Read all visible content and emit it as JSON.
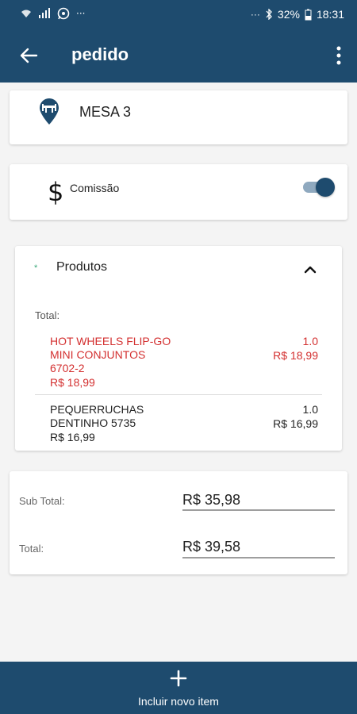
{
  "status_bar": {
    "battery": "32%",
    "time": "18:31",
    "left_icons": [
      "wifi-icon",
      "signal-icon",
      "whatsapp-icon",
      "more-icon"
    ],
    "right_icons": [
      "more-icon",
      "bluetooth-icon",
      "battery-icon"
    ]
  },
  "app_bar": {
    "title": "pedido",
    "back_icon": "arrow-back-icon",
    "menu_icon": "more-vert-icon"
  },
  "mesa": {
    "icon": "table-pin-icon",
    "label": "MESA 3"
  },
  "comissao": {
    "icon": "dollar-icon",
    "symbol": "$",
    "label": "Comissão",
    "enabled": true
  },
  "produtos": {
    "star": "*",
    "title": "Produtos",
    "expanded": true,
    "total_label": "Total:",
    "items": [
      {
        "name_lines": [
          "HOT WHEELS FLIP-GO",
          "MINI CONJUNTOS",
          "6702-2"
        ],
        "qty": "1.0",
        "price": "R$ 18,99",
        "price_left": "R$ 18,99",
        "color": "#d32f2f"
      },
      {
        "name_lines": [
          "PEQUERRUCHAS",
          "DENTINHO 5735"
        ],
        "qty": "1.0",
        "price": "R$ 16,99",
        "price_left": "R$ 16,99",
        "color": "#222222"
      }
    ]
  },
  "totals": {
    "subtotal_label": "Sub Total:",
    "subtotal_value": "R$ 35,98",
    "total_label": "Total:",
    "total_value": "R$ 39,58"
  },
  "bottom_bar": {
    "icon": "plus-icon",
    "label": "Incluir novo item"
  },
  "colors": {
    "primary": "#1e4b6e",
    "accent_red": "#d32f2f",
    "star_green": "#3aa87a"
  }
}
